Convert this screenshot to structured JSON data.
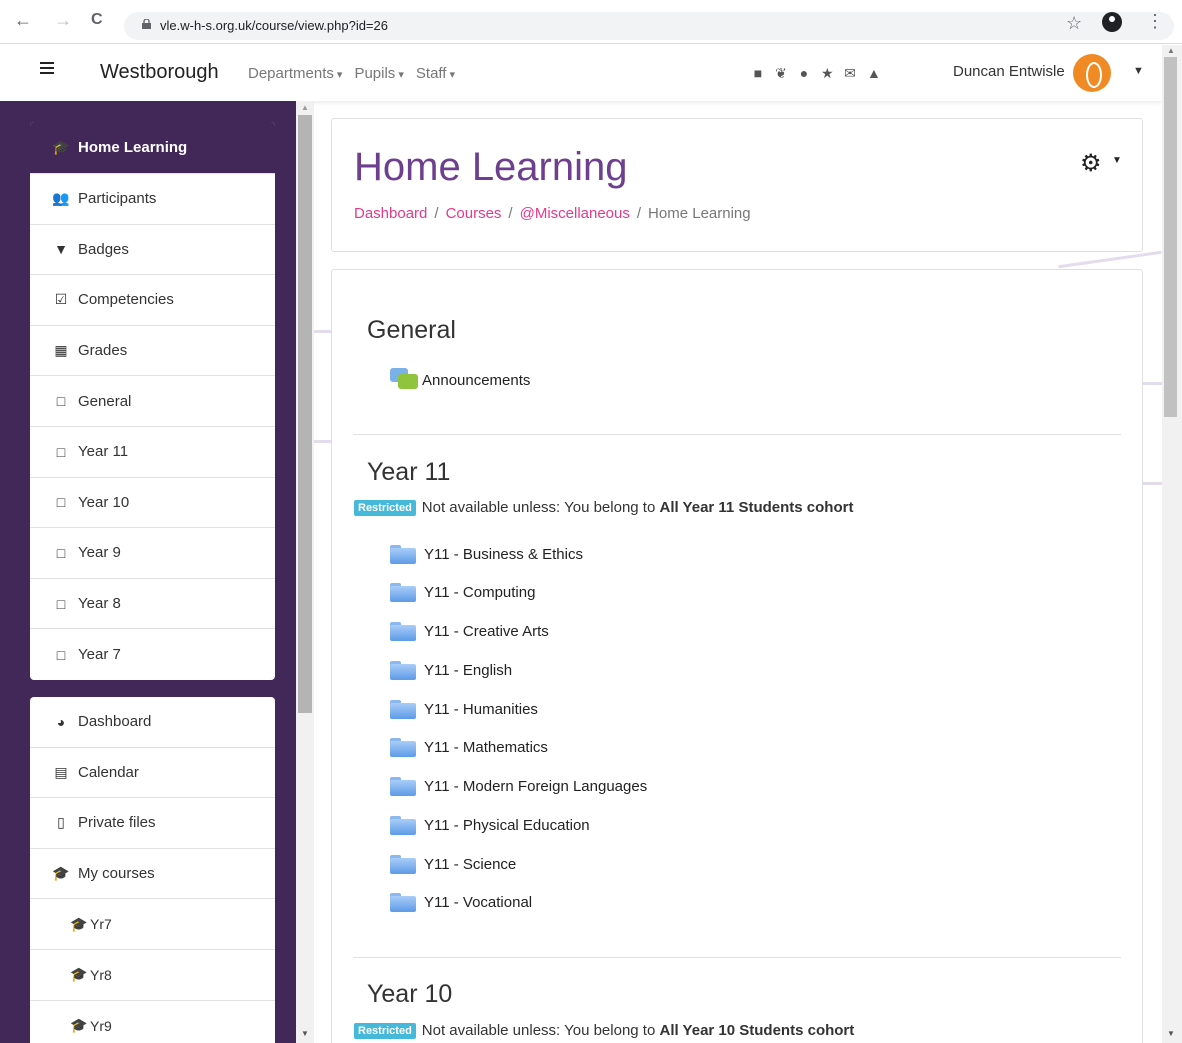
{
  "browser": {
    "back_icon": "←",
    "forward_icon": "→",
    "reload_icon": "C",
    "url": "vle.w-h-s.org.uk/course/view.php?id=26",
    "star_icon": "☆",
    "menu_icon": "⋮"
  },
  "navbar": {
    "site_name": "Westborough",
    "menu": [
      "Departments",
      "Pupils",
      "Staff"
    ],
    "icons": [
      "book-icon",
      "twitter-icon",
      "globe-icon",
      "star-icon",
      "envelope-icon",
      "bell-icon"
    ],
    "icon_glyphs": [
      "■",
      "❦",
      "●",
      "★",
      "✉",
      "▲"
    ],
    "user_name": "Duncan Entwisle"
  },
  "drawer": {
    "course_nav": [
      {
        "label": "Home Learning",
        "icon": "graduation-cap-icon",
        "glyph": "🎓",
        "active": true
      },
      {
        "label": "Participants",
        "icon": "users-icon",
        "glyph": "👥"
      },
      {
        "label": "Badges",
        "icon": "shield-icon",
        "glyph": "▼"
      },
      {
        "label": "Competencies",
        "icon": "check-square-icon",
        "glyph": "☑"
      },
      {
        "label": "Grades",
        "icon": "table-icon",
        "glyph": "▦"
      },
      {
        "label": "General",
        "icon": "folder-icon",
        "glyph": "□"
      },
      {
        "label": "Year 11",
        "icon": "folder-icon",
        "glyph": "□"
      },
      {
        "label": "Year 10",
        "icon": "folder-icon",
        "glyph": "□"
      },
      {
        "label": "Year 9",
        "icon": "folder-icon",
        "glyph": "□"
      },
      {
        "label": "Year 8",
        "icon": "folder-icon",
        "glyph": "□"
      },
      {
        "label": "Year 7",
        "icon": "folder-icon",
        "glyph": "□"
      }
    ],
    "site_nav": [
      {
        "label": "Dashboard",
        "icon": "dashboard-icon",
        "glyph": "◕"
      },
      {
        "label": "Calendar",
        "icon": "calendar-icon",
        "glyph": "▤"
      },
      {
        "label": "Private files",
        "icon": "file-icon",
        "glyph": "▯"
      },
      {
        "label": "My courses",
        "icon": "graduation-cap-icon",
        "glyph": "🎓"
      },
      {
        "label": "Yr7",
        "icon": "graduation-cap-icon",
        "glyph": "🎓",
        "indent": true
      },
      {
        "label": "Yr8",
        "icon": "graduation-cap-icon",
        "glyph": "🎓",
        "indent": true
      },
      {
        "label": "Yr9",
        "icon": "graduation-cap-icon",
        "glyph": "🎓",
        "indent": true
      }
    ]
  },
  "header": {
    "title": "Home Learning",
    "breadcrumb": [
      {
        "label": "Dashboard",
        "link": true
      },
      {
        "label": "Courses",
        "link": true
      },
      {
        "label": "@Miscellaneous",
        "link": true
      },
      {
        "label": "Home Learning",
        "link": false
      }
    ]
  },
  "sections": {
    "general": {
      "title": "General",
      "activities": [
        "Announcements"
      ]
    },
    "year11": {
      "title": "Year 11",
      "badge": "Restricted",
      "restriction_text": "Not available unless: You belong to ",
      "restriction_cohort": "All Year 11 Students cohort",
      "folders": [
        "Y11 - Business & Ethics",
        "Y11 - Computing",
        "Y11 - Creative Arts",
        "Y11 - English",
        "Y11 - Humanities",
        "Y11 - Mathematics",
        "Y11 - Modern Foreign Languages",
        "Y11 - Physical Education",
        "Y11 - Science",
        "Y11 - Vocational"
      ]
    },
    "year10": {
      "title": "Year 10",
      "badge": "Restricted",
      "restriction_text": "Not available unless: You belong to ",
      "restriction_cohort": "All Year 10 Students cohort"
    }
  },
  "colors": {
    "theme_purple": "#422759",
    "title_purple": "#6d3f8e",
    "link_pink": "#e8388c",
    "badge_blue": "#46b8da"
  }
}
